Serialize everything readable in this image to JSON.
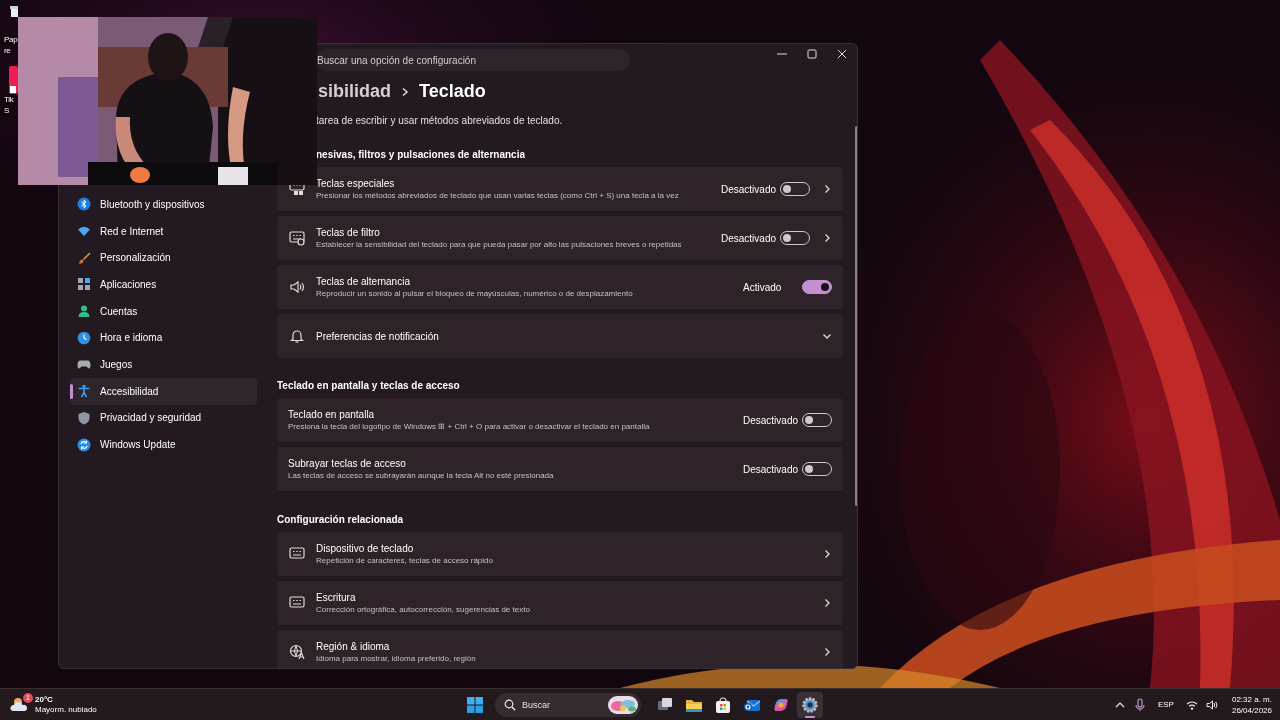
{
  "desktop_icons": [
    {
      "lines": [
        "Pap",
        "re"
      ]
    },
    {
      "lines": [
        "Tik",
        "S"
      ]
    }
  ],
  "settings": {
    "search": {
      "placeholder": "Buscar una opción de configuración"
    },
    "breadcrumb": {
      "parent": "sibilidad",
      "current": "Teclado"
    },
    "description": "tarea de escribir y usar métodos abreviados de teclado.",
    "sidebar": {
      "items": [
        {
          "label": "Bluetooth y dispositivos",
          "selected": false
        },
        {
          "label": "Red e Internet",
          "selected": false
        },
        {
          "label": "Personalización",
          "selected": false
        },
        {
          "label": "Aplicaciones",
          "selected": false
        },
        {
          "label": "Cuentas",
          "selected": false
        },
        {
          "label": "Hora e idioma",
          "selected": false
        },
        {
          "label": "Juegos",
          "selected": false
        },
        {
          "label": "Accesibilidad",
          "selected": true
        },
        {
          "label": "Privacidad y seguridad",
          "selected": false
        },
        {
          "label": "Windows Update",
          "selected": false
        }
      ]
    },
    "sections": [
      {
        "title": "nesivas, filtros y pulsaciones de alternancia",
        "cards": [
          {
            "kind": "toggle-nav",
            "title": "Teclas especiales",
            "subtitle": "Presionar los métodos abreviados de teclado que usan varias teclas (como Ctrl + S) una tecla a la vez",
            "state_label": "Desactivado",
            "on": false
          },
          {
            "kind": "toggle-nav",
            "title": "Teclas de filtro",
            "subtitle": "Establecer la sensibilidad del teclado para que pueda pasar por alto las pulsaciones breves o repetidas",
            "state_label": "Desactivado",
            "on": false
          },
          {
            "kind": "toggle",
            "title": "Teclas de alternancia",
            "subtitle": "Reproducir un sonido al pulsar el bloqueo de mayúsculas, numérico o de desplazamiento",
            "state_label": "Activado",
            "on": true
          },
          {
            "kind": "expander",
            "title": "Preferencias de notificación",
            "expanded": false
          }
        ]
      },
      {
        "title": "Teclado en pantalla y teclas de acceso",
        "cards": [
          {
            "kind": "toggle",
            "title": "Teclado en pantalla",
            "subtitle": "Presiona la tecla del logotipo de Windows ⊞ + Ctrl + O para activar o desactivar el teclado en pantalla",
            "state_label": "Desactivado",
            "on": false
          },
          {
            "kind": "toggle",
            "title": "Subrayar teclas de acceso",
            "subtitle": "Las teclas de acceso se subrayarán aunque la tecla Alt no esté presionada",
            "state_label": "Desactivado",
            "on": false
          }
        ]
      },
      {
        "title": "Configuración relacionada",
        "cards": [
          {
            "kind": "nav",
            "title": "Dispositivo de teclado",
            "subtitle": "Repetición de caracteres, teclas de acceso rápido"
          },
          {
            "kind": "nav",
            "title": "Escritura",
            "subtitle": "Corrección ortográfica, autocorrección, sugerencias de texto"
          },
          {
            "kind": "nav",
            "title": "Región & idioma",
            "subtitle": "Idioma para mostrar, idioma preferido, región"
          }
        ]
      }
    ]
  },
  "taskbar": {
    "weather": {
      "badge": "1",
      "temperature": "20°C",
      "condition": "Mayorm. nublado"
    },
    "search": {
      "placeholder": "Buscar"
    },
    "apps": [
      {
        "selected": false
      },
      {
        "selected": false
      },
      {
        "selected": false
      },
      {
        "selected": false
      },
      {
        "selected": false
      },
      {
        "selected": true
      }
    ],
    "language": "ESP",
    "time": "02:32 a. m.",
    "date": "26/04/2026"
  }
}
